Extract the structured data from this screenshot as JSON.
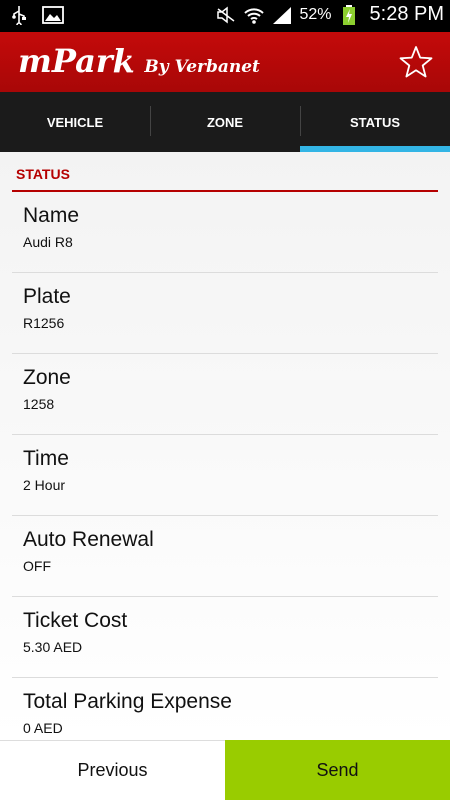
{
  "statusbar": {
    "battery": "52%",
    "time": "5:28 PM",
    "icons": [
      "usb-icon",
      "image-icon",
      "mute-icon",
      "wifi-icon",
      "signal-icon",
      "battery-charging-icon"
    ]
  },
  "app": {
    "title": "mPark",
    "subtitle": "By Verbanet"
  },
  "tabs": [
    {
      "label": "VEHICLE",
      "active": false
    },
    {
      "label": "ZONE",
      "active": false
    },
    {
      "label": "STATUS",
      "active": true
    }
  ],
  "section": {
    "title": "STATUS"
  },
  "rows": [
    {
      "label": "Name",
      "value": "Audi R8"
    },
    {
      "label": "Plate",
      "value": "R1256"
    },
    {
      "label": "Zone",
      "value": "1258"
    },
    {
      "label": "Time",
      "value": "2 Hour"
    },
    {
      "label": "Auto Renewal",
      "value": "OFF"
    },
    {
      "label": "Ticket Cost",
      "value": "5.30 AED"
    },
    {
      "label": "Total Parking Expense",
      "value": "0 AED"
    }
  ],
  "buttons": {
    "previous": "Previous",
    "send": "Send"
  },
  "colors": {
    "brand_red": "#b50000",
    "tab_indicator": "#33b5e5",
    "send_green": "#99cc00"
  }
}
